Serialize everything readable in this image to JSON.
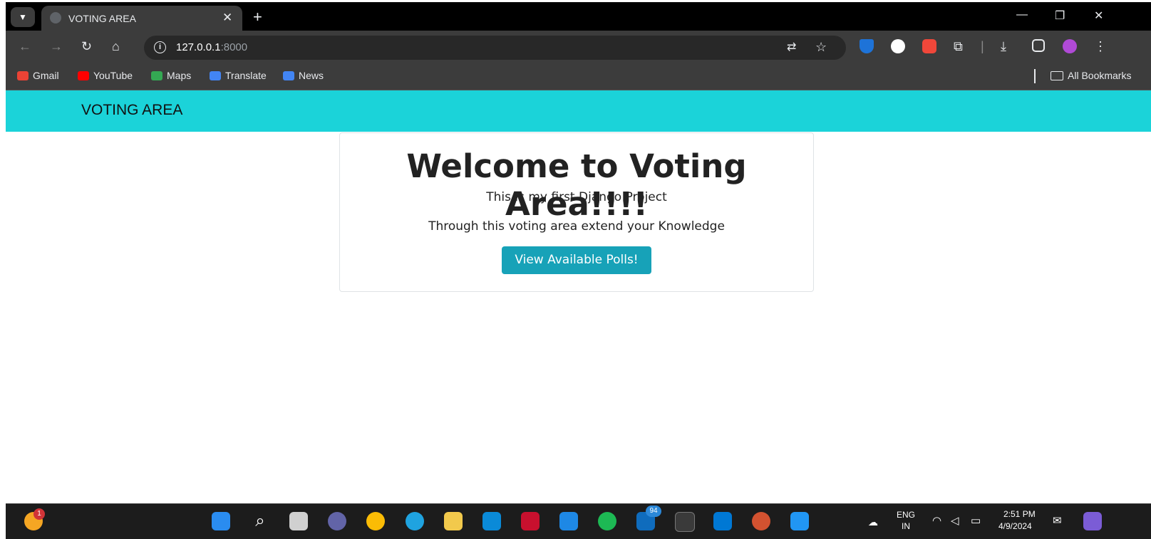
{
  "browser": {
    "tab_title": "VOTING AREA",
    "url_host": "127.0.0.1",
    "url_port": ":8000",
    "bookmarks": [
      "Gmail",
      "YouTube",
      "Maps",
      "Translate",
      "News"
    ],
    "all_bookmarks": "All Bookmarks"
  },
  "page": {
    "navbar_brand": "VOTING AREA",
    "heading": "Welcome to Voting Area!!!!",
    "subtitle": "This is my first Django Project",
    "description": "Through this voting area extend your Knowledge",
    "button_label": "View Available Polls!"
  },
  "taskbar": {
    "weather_badge": "1",
    "outlook_badge": "94",
    "language": "ENG",
    "region": "IN",
    "time": "2:51 PM",
    "date": "4/9/2024"
  },
  "colors": {
    "navbar": "#1bd3d9",
    "button": "#17a2b8"
  }
}
